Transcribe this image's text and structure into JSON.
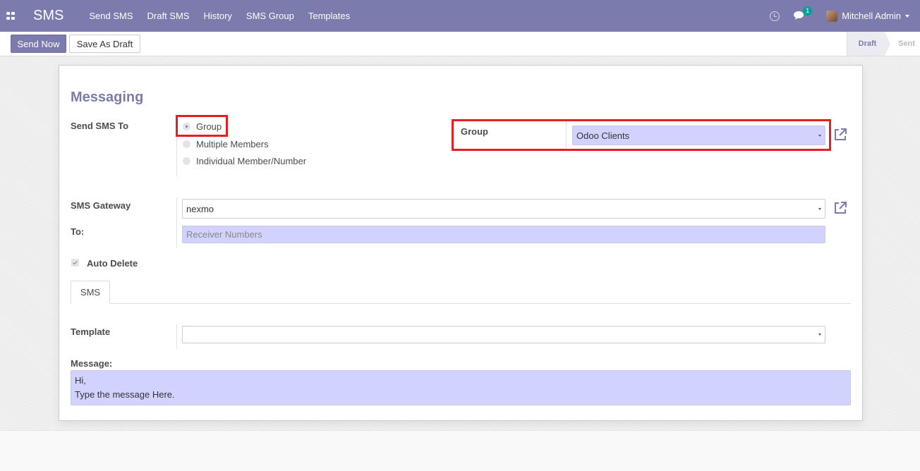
{
  "navbar": {
    "app_title": "SMS",
    "menu": [
      "Send SMS",
      "Draft SMS",
      "History",
      "SMS Group",
      "Templates"
    ],
    "message_count": "1",
    "user_name": "Mitchell Admin",
    "bg_color": "#7c7bad"
  },
  "control": {
    "send_now_label": "Send Now",
    "save_draft_label": "Save As Draft",
    "status_draft": "Draft",
    "status_sent": "Sent"
  },
  "form": {
    "title": "Messaging",
    "send_sms_to_label": "Send SMS To",
    "send_options": [
      {
        "label": "Group",
        "checked": true
      },
      {
        "label": "Multiple Members",
        "checked": false
      },
      {
        "label": "Individual Member/Number",
        "checked": false
      }
    ],
    "group_label": "Group",
    "group_value": "Odoo Clients",
    "gateway_label": "SMS Gateway",
    "gateway_value": "nexmo",
    "to_label": "To:",
    "to_placeholder": "Receiver Numbers",
    "auto_delete_label": "Auto Delete",
    "auto_delete_checked": true,
    "tab_label": "SMS",
    "template_label": "Template",
    "template_value": "",
    "message_label": "Message:",
    "message_line1": "Hi,",
    "message_line2": "Type the message Here."
  },
  "colors": {
    "accent": "#7c7bad",
    "required_field": "#d2d2ff",
    "highlight": "#e41e22"
  }
}
